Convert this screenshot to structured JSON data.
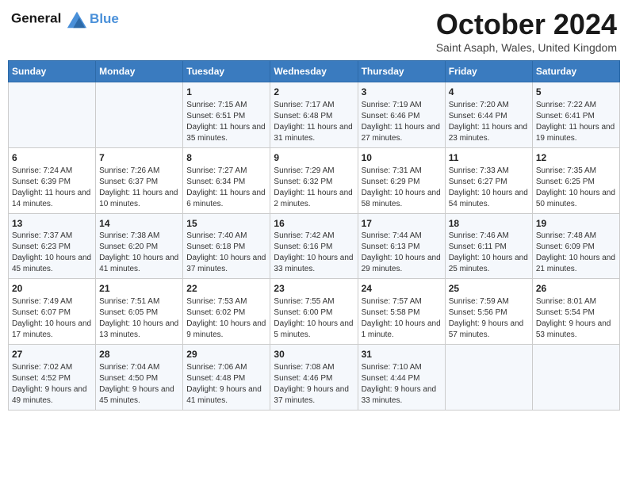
{
  "logo": {
    "line1": "General",
    "line2": "Blue"
  },
  "title": "October 2024",
  "subtitle": "Saint Asaph, Wales, United Kingdom",
  "weekdays": [
    "Sunday",
    "Monday",
    "Tuesday",
    "Wednesday",
    "Thursday",
    "Friday",
    "Saturday"
  ],
  "weeks": [
    [
      {
        "day": "",
        "info": ""
      },
      {
        "day": "",
        "info": ""
      },
      {
        "day": "1",
        "info": "Sunrise: 7:15 AM\nSunset: 6:51 PM\nDaylight: 11 hours and 35 minutes."
      },
      {
        "day": "2",
        "info": "Sunrise: 7:17 AM\nSunset: 6:48 PM\nDaylight: 11 hours and 31 minutes."
      },
      {
        "day": "3",
        "info": "Sunrise: 7:19 AM\nSunset: 6:46 PM\nDaylight: 11 hours and 27 minutes."
      },
      {
        "day": "4",
        "info": "Sunrise: 7:20 AM\nSunset: 6:44 PM\nDaylight: 11 hours and 23 minutes."
      },
      {
        "day": "5",
        "info": "Sunrise: 7:22 AM\nSunset: 6:41 PM\nDaylight: 11 hours and 19 minutes."
      }
    ],
    [
      {
        "day": "6",
        "info": "Sunrise: 7:24 AM\nSunset: 6:39 PM\nDaylight: 11 hours and 14 minutes."
      },
      {
        "day": "7",
        "info": "Sunrise: 7:26 AM\nSunset: 6:37 PM\nDaylight: 11 hours and 10 minutes."
      },
      {
        "day": "8",
        "info": "Sunrise: 7:27 AM\nSunset: 6:34 PM\nDaylight: 11 hours and 6 minutes."
      },
      {
        "day": "9",
        "info": "Sunrise: 7:29 AM\nSunset: 6:32 PM\nDaylight: 11 hours and 2 minutes."
      },
      {
        "day": "10",
        "info": "Sunrise: 7:31 AM\nSunset: 6:29 PM\nDaylight: 10 hours and 58 minutes."
      },
      {
        "day": "11",
        "info": "Sunrise: 7:33 AM\nSunset: 6:27 PM\nDaylight: 10 hours and 54 minutes."
      },
      {
        "day": "12",
        "info": "Sunrise: 7:35 AM\nSunset: 6:25 PM\nDaylight: 10 hours and 50 minutes."
      }
    ],
    [
      {
        "day": "13",
        "info": "Sunrise: 7:37 AM\nSunset: 6:23 PM\nDaylight: 10 hours and 45 minutes."
      },
      {
        "day": "14",
        "info": "Sunrise: 7:38 AM\nSunset: 6:20 PM\nDaylight: 10 hours and 41 minutes."
      },
      {
        "day": "15",
        "info": "Sunrise: 7:40 AM\nSunset: 6:18 PM\nDaylight: 10 hours and 37 minutes."
      },
      {
        "day": "16",
        "info": "Sunrise: 7:42 AM\nSunset: 6:16 PM\nDaylight: 10 hours and 33 minutes."
      },
      {
        "day": "17",
        "info": "Sunrise: 7:44 AM\nSunset: 6:13 PM\nDaylight: 10 hours and 29 minutes."
      },
      {
        "day": "18",
        "info": "Sunrise: 7:46 AM\nSunset: 6:11 PM\nDaylight: 10 hours and 25 minutes."
      },
      {
        "day": "19",
        "info": "Sunrise: 7:48 AM\nSunset: 6:09 PM\nDaylight: 10 hours and 21 minutes."
      }
    ],
    [
      {
        "day": "20",
        "info": "Sunrise: 7:49 AM\nSunset: 6:07 PM\nDaylight: 10 hours and 17 minutes."
      },
      {
        "day": "21",
        "info": "Sunrise: 7:51 AM\nSunset: 6:05 PM\nDaylight: 10 hours and 13 minutes."
      },
      {
        "day": "22",
        "info": "Sunrise: 7:53 AM\nSunset: 6:02 PM\nDaylight: 10 hours and 9 minutes."
      },
      {
        "day": "23",
        "info": "Sunrise: 7:55 AM\nSunset: 6:00 PM\nDaylight: 10 hours and 5 minutes."
      },
      {
        "day": "24",
        "info": "Sunrise: 7:57 AM\nSunset: 5:58 PM\nDaylight: 10 hours and 1 minute."
      },
      {
        "day": "25",
        "info": "Sunrise: 7:59 AM\nSunset: 5:56 PM\nDaylight: 9 hours and 57 minutes."
      },
      {
        "day": "26",
        "info": "Sunrise: 8:01 AM\nSunset: 5:54 PM\nDaylight: 9 hours and 53 minutes."
      }
    ],
    [
      {
        "day": "27",
        "info": "Sunrise: 7:02 AM\nSunset: 4:52 PM\nDaylight: 9 hours and 49 minutes."
      },
      {
        "day": "28",
        "info": "Sunrise: 7:04 AM\nSunset: 4:50 PM\nDaylight: 9 hours and 45 minutes."
      },
      {
        "day": "29",
        "info": "Sunrise: 7:06 AM\nSunset: 4:48 PM\nDaylight: 9 hours and 41 minutes."
      },
      {
        "day": "30",
        "info": "Sunrise: 7:08 AM\nSunset: 4:46 PM\nDaylight: 9 hours and 37 minutes."
      },
      {
        "day": "31",
        "info": "Sunrise: 7:10 AM\nSunset: 4:44 PM\nDaylight: 9 hours and 33 minutes."
      },
      {
        "day": "",
        "info": ""
      },
      {
        "day": "",
        "info": ""
      }
    ]
  ]
}
